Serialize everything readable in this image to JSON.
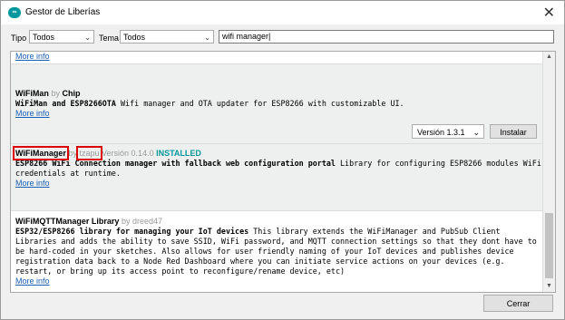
{
  "window": {
    "title": "Gestor de Liberías",
    "icon": "arduino-icon",
    "close_icon": "close-icon"
  },
  "filters": {
    "type_label": "Tipo",
    "type_value": "Todos",
    "topic_label": "Tema",
    "topic_value": "Todos",
    "search_value": "wifi manager"
  },
  "libraries": [
    {
      "more_info": "More info"
    },
    {
      "name": "WiFiMan",
      "by": "by",
      "author": "Chip",
      "sentence": "WiFiMan and ESP8266OTA",
      "description": "Wifi manager and OTA updater for ESP8266 with customizable UI.",
      "more_info": "More info",
      "version_select": "Versión 1.3.1",
      "install_label": "Instalar"
    },
    {
      "name": "WiFiManager",
      "by": "by",
      "author": "tzapu",
      "version_label": "Versión 0.14.0",
      "status": "INSTALLED",
      "sentence": "ESP8266 WiFi Connection manager with fallback web configuration portal",
      "description": "Library for configuring ESP8266 modules WiFi credentials at runtime.",
      "more_info": "More info"
    },
    {
      "name": "WiFiMQTTManager Library",
      "by": "by",
      "author": "dreed47",
      "sentence": "ESP32/ESP8266 library for managing your IoT devices",
      "description": "This library extends the WiFiManager and PubSub Client Libraries and adds the ability to save SSID, WiFi password, and MQTT connection settings so that they dont have to be hard-coded in your sketches. Also allows for user friendly naming of your IoT devices and publishes device registration data back to a Node Red Dashboard where you can initiate service actions on your devices (e.g. restart, or bring up its access point to reconfigure/rename device, etc)",
      "more_info": "More info"
    }
  ],
  "footer": {
    "close_label": "Cerrar"
  },
  "colors": {
    "link": "#1a5fb4",
    "installed": "#00979c",
    "highlight": "#dd0000"
  }
}
